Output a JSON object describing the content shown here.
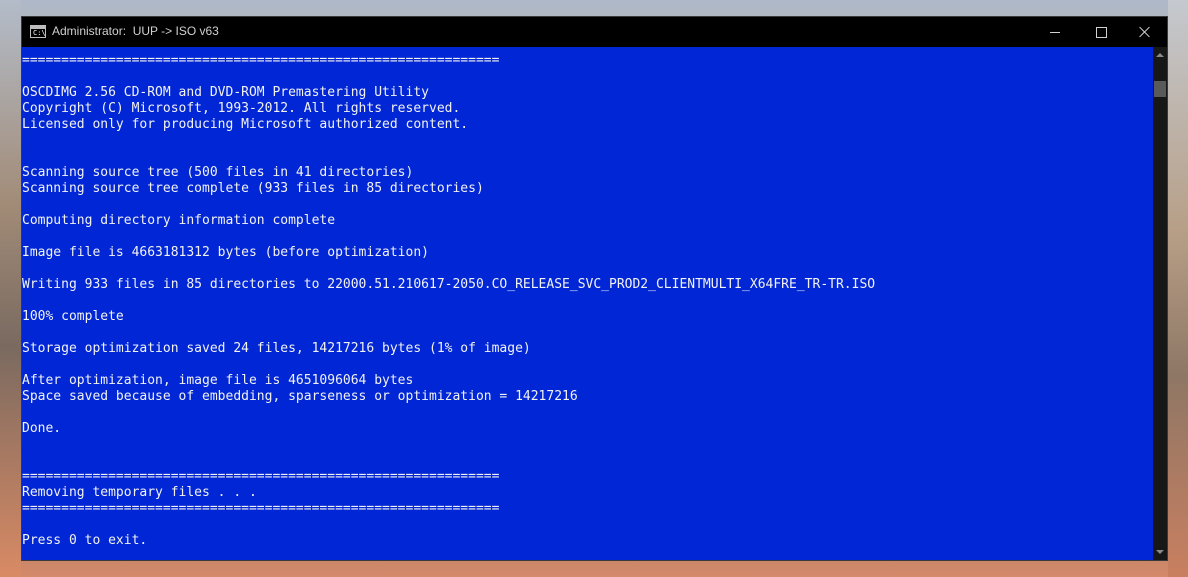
{
  "window": {
    "title": "Administrator:  UUP -> ISO v63",
    "icon": "cmd-icon",
    "icon_text": "C:\\"
  },
  "console": {
    "background_color": "#0026d6",
    "text_color": "#f2f2f2",
    "lines": [
      "=============================================================",
      "",
      "OSCDIMG 2.56 CD-ROM and DVD-ROM Premastering Utility",
      "Copyright (C) Microsoft, 1993-2012. All rights reserved.",
      "Licensed only for producing Microsoft authorized content.",
      "",
      "",
      "Scanning source tree (500 files in 41 directories)",
      "Scanning source tree complete (933 files in 85 directories)",
      "",
      "Computing directory information complete",
      "",
      "Image file is 4663181312 bytes (before optimization)",
      "",
      "Writing 933 files in 85 directories to 22000.51.210617-2050.CO_RELEASE_SVC_PROD2_CLIENTMULTI_X64FRE_TR-TR.ISO",
      "",
      "100% complete",
      "",
      "Storage optimization saved 24 files, 14217216 bytes (1% of image)",
      "",
      "After optimization, image file is 4651096064 bytes",
      "Space saved because of embedding, sparseness or optimization = 14217216",
      "",
      "Done.",
      "",
      "",
      "=============================================================",
      "Removing temporary files . . .",
      "=============================================================",
      "",
      "Press 0 to exit."
    ]
  },
  "scrollbar": {
    "position": 0.03
  }
}
